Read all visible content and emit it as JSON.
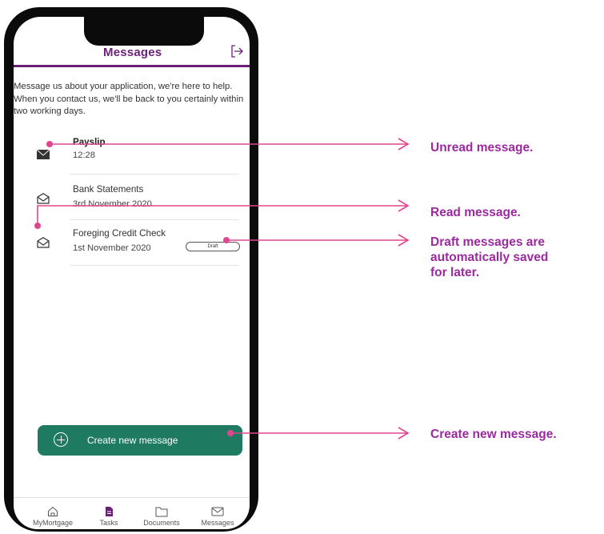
{
  "header": {
    "title": "Messages"
  },
  "intro": "Message us about your application, we're here to help. When you contact us, we'll be back to you certainly within two working days.",
  "messages": [
    {
      "subject": "Payslip",
      "time": "12:28",
      "status": "unread"
    },
    {
      "subject": "Bank Statements",
      "time": "3rd November 2020",
      "status": "read"
    },
    {
      "subject": "Foreging Credit Check",
      "time": "1st November 2020",
      "status": "read",
      "badge": "Draft"
    }
  ],
  "create_button": {
    "label": "Create new message"
  },
  "tabs": [
    {
      "label": "MyMortgage",
      "icon": "home-icon"
    },
    {
      "label": "Tasks",
      "icon": "document-filled-icon"
    },
    {
      "label": "Documents",
      "icon": "folder-icon"
    },
    {
      "label": "Messages",
      "icon": "envelope-icon"
    }
  ],
  "callouts": {
    "unread": "Unread message.",
    "read": "Read message.",
    "draft_line1": "Draft messages are",
    "draft_line2": "automatically saved",
    "draft_line3": "for later.",
    "create": "Create new message."
  },
  "colors": {
    "brand": "#6b1f77",
    "button": "#1e7a60",
    "annotation": "#e0468e",
    "callout_text": "#9b2a9f"
  }
}
